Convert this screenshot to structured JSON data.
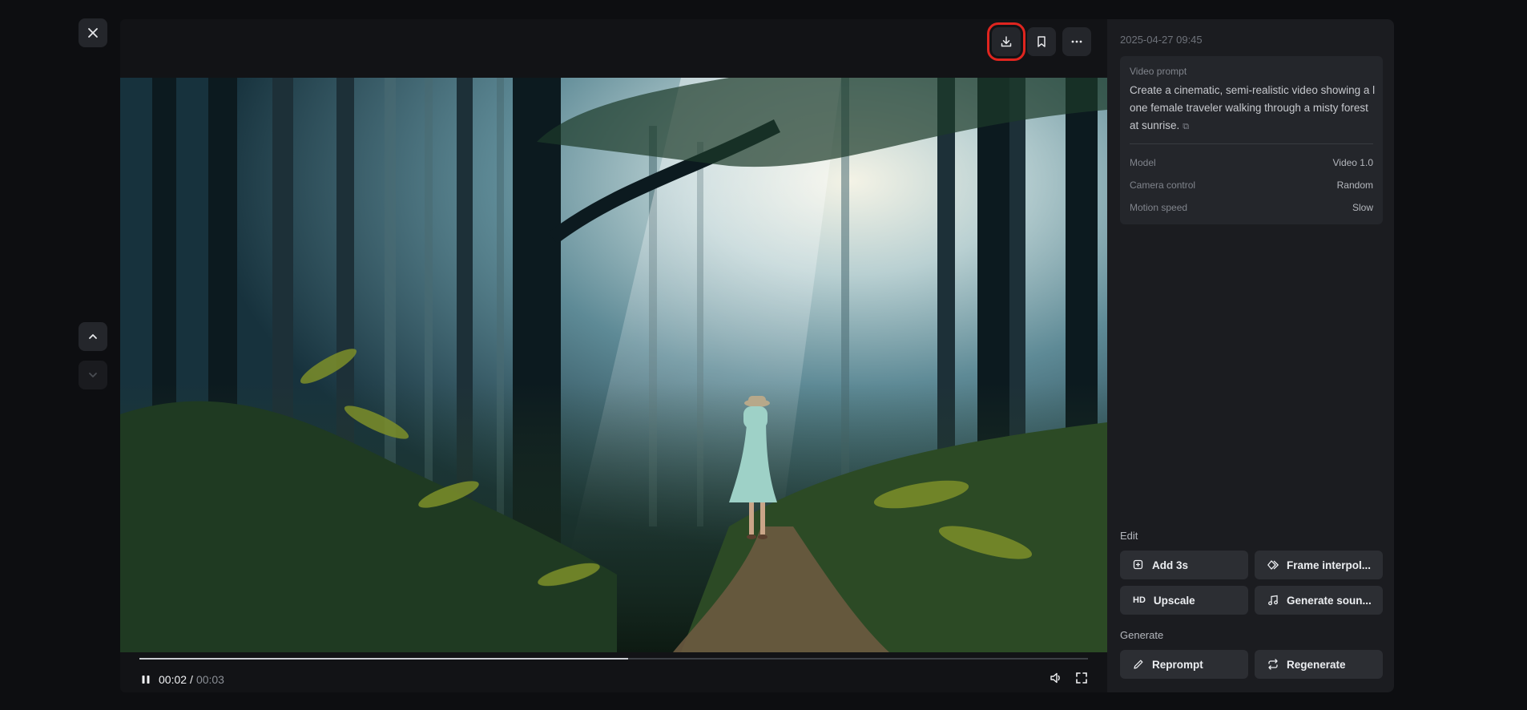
{
  "nav": {
    "close_icon": "close-icon",
    "prev_icon": "chevron-up-icon",
    "next_icon": "chevron-down-icon"
  },
  "toolbar": {
    "download_icon": "download-icon",
    "bookmark_icon": "bookmark-icon",
    "more_icon": "more-icon",
    "highlight_color": "#e0251f"
  },
  "player": {
    "current_time": "00:02",
    "separator": "/",
    "duration": "00:03",
    "progress": 0.515,
    "play_state_icon": "pause-icon",
    "volume_icon": "volume-icon",
    "fullscreen_icon": "fullscreen-icon"
  },
  "details": {
    "timestamp": "2025-04-27 09:45",
    "prompt_label": "Video prompt",
    "prompt_text": "Create a cinematic, semi-realistic video showing a l one female traveler walking through a misty forest at sunrise.",
    "copy_icon": "copy-icon",
    "fields": [
      {
        "key": "Model",
        "value": "Video 1.0"
      },
      {
        "key": "Camera control",
        "value": "Random"
      },
      {
        "key": "Motion speed",
        "value": "Slow"
      }
    ]
  },
  "edit": {
    "label": "Edit",
    "buttons": [
      {
        "label": "Add 3s",
        "icon": "add-time-icon"
      },
      {
        "label": "Frame interpol...",
        "icon": "diamond-icon"
      },
      {
        "label": "Upscale",
        "icon": "hd-icon",
        "icon_text": "HD"
      },
      {
        "label": "Generate soun...",
        "icon": "music-icon"
      }
    ]
  },
  "generate": {
    "label": "Generate",
    "buttons": [
      {
        "label": "Reprompt",
        "icon": "pencil-icon"
      },
      {
        "label": "Regenerate",
        "icon": "repeat-icon"
      }
    ]
  }
}
